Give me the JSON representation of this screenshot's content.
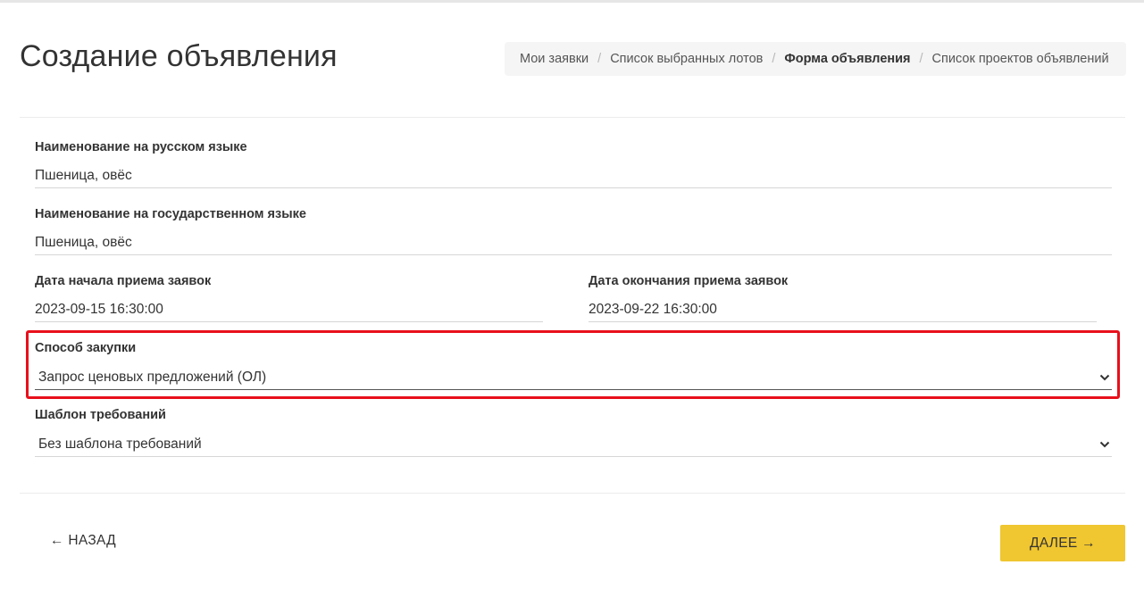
{
  "page": {
    "title": "Создание объявления"
  },
  "breadcrumb": {
    "items": [
      {
        "label": "Мои заявки",
        "active": false
      },
      {
        "label": "Список выбранных лотов",
        "active": false
      },
      {
        "label": "Форма объявления",
        "active": true
      },
      {
        "label": "Список проектов объявлений",
        "active": false
      }
    ],
    "separator": "/"
  },
  "form": {
    "name_ru": {
      "label": "Наименование на русском языке",
      "value": "Пшеница, овёс"
    },
    "name_kz": {
      "label": "Наименование на государственном языке",
      "value": "Пшеница, овёс"
    },
    "date_start": {
      "label": "Дата начала приема заявок",
      "value": "2023-09-15 16:30:00"
    },
    "date_end": {
      "label": "Дата окончания приема заявок",
      "value": "2023-09-22 16:30:00"
    },
    "procurement_method": {
      "label": "Способ закупки",
      "selected": "Запрос ценовых предложений (ОЛ)",
      "highlighted": true,
      "highlight_color": "#e8101b"
    },
    "requirements_template": {
      "label": "Шаблон требований",
      "selected": "Без шаблона требований"
    }
  },
  "actions": {
    "back_label": "← НАЗАД",
    "next_label": "ДАЛЕЕ →",
    "next_color": "#f0c631"
  },
  "icons": {
    "select_chevron": "chevron-down-icon"
  }
}
